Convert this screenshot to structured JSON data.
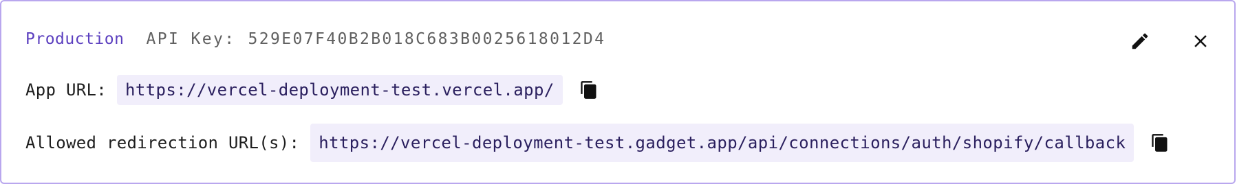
{
  "header": {
    "environment": "Production",
    "api_key_label": "API Key:",
    "api_key_value": "529E07F40B2B018C683B0025618012D4"
  },
  "actions": {
    "edit_icon": "pencil-icon",
    "close_icon": "close-icon"
  },
  "app_url": {
    "label": "App URL:",
    "value": "https://vercel-deployment-test.vercel.app/",
    "copy_icon": "copy-icon"
  },
  "redirection": {
    "label": "Allowed redirection URL(s):",
    "value": "https://vercel-deployment-test.gadget.app/api/connections/auth/shopify/callback",
    "copy_icon": "copy-icon"
  },
  "colors": {
    "accent": "#5b3fbf",
    "border": "#b9a7ee",
    "chip_bg": "#f1eefb",
    "chip_text": "#2a1f5e"
  }
}
